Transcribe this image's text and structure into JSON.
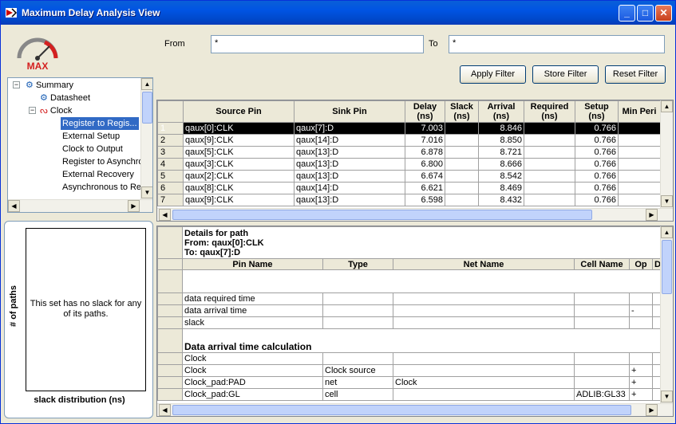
{
  "window": {
    "title": "Maximum Delay Analysis View",
    "min_icon": "minimize-icon",
    "max_icon": "maximize-icon",
    "close_icon": "close-icon"
  },
  "left": {
    "logo_text": "MAX",
    "tree": [
      {
        "label": "Summary",
        "icon": "summary-icon",
        "level": 0,
        "expander": "⊟"
      },
      {
        "label": "Datasheet",
        "icon": "datasheet-icon",
        "level": 1
      },
      {
        "label": "Clock",
        "icon": "clock-icon",
        "level": 1,
        "expander": "⊟"
      },
      {
        "label": "Register to Regis...",
        "level": 2,
        "selected": true
      },
      {
        "label": "External Setup",
        "level": 2
      },
      {
        "label": "Clock to Output",
        "level": 2
      },
      {
        "label": "Register to Asynchro",
        "level": 2
      },
      {
        "label": "External Recovery",
        "level": 2
      },
      {
        "label": "Asynchronous to Re",
        "level": 2
      }
    ],
    "histogram": {
      "ylabel": "# of paths",
      "xlabel": "slack distribution (ns)",
      "message": "This set has no slack for any of its paths."
    }
  },
  "filter": {
    "from_label": "From",
    "from_value": "*",
    "to_label": "To",
    "to_value": "*",
    "apply": "Apply Filter",
    "store": "Store Filter",
    "reset": "Reset Filter"
  },
  "paths_table": {
    "columns": [
      "Source Pin",
      "Sink Pin",
      "Delay (ns)",
      "Slack (ns)",
      "Arrival (ns)",
      "Required (ns)",
      "Setup (ns)",
      "Min Peri"
    ],
    "rows": [
      {
        "n": "1",
        "src": "qaux[0]:CLK",
        "sink": "qaux[7]:D",
        "delay": "7.003",
        "slack": "",
        "arrival": "8.846",
        "required": "",
        "setup": "0.766"
      },
      {
        "n": "2",
        "src": "qaux[9]:CLK",
        "sink": "qaux[14]:D",
        "delay": "7.016",
        "slack": "",
        "arrival": "8.850",
        "required": "",
        "setup": "0.766"
      },
      {
        "n": "3",
        "src": "qaux[5]:CLK",
        "sink": "qaux[13]:D",
        "delay": "6.878",
        "slack": "",
        "arrival": "8.721",
        "required": "",
        "setup": "0.766"
      },
      {
        "n": "4",
        "src": "qaux[3]:CLK",
        "sink": "qaux[13]:D",
        "delay": "6.800",
        "slack": "",
        "arrival": "8.666",
        "required": "",
        "setup": "0.766"
      },
      {
        "n": "5",
        "src": "qaux[2]:CLK",
        "sink": "qaux[13]:D",
        "delay": "6.674",
        "slack": "",
        "arrival": "8.542",
        "required": "",
        "setup": "0.766"
      },
      {
        "n": "6",
        "src": "qaux[8]:CLK",
        "sink": "qaux[14]:D",
        "delay": "6.621",
        "slack": "",
        "arrival": "8.469",
        "required": "",
        "setup": "0.766"
      },
      {
        "n": "7",
        "src": "qaux[9]:CLK",
        "sink": "qaux[13]:D",
        "delay": "6.598",
        "slack": "",
        "arrival": "8.432",
        "required": "",
        "setup": "0.766"
      }
    ]
  },
  "details": {
    "title": "Details for path",
    "from": "From: qaux[0]:CLK",
    "to": "To: qaux[7]:D",
    "columns": [
      "Pin Name",
      "Type",
      "Net Name",
      "Cell Name",
      "Op",
      "D"
    ],
    "rows": [
      {
        "pin": "data required time",
        "type": "",
        "net": "",
        "cell": "",
        "op": ""
      },
      {
        "pin": "data arrival time",
        "type": "",
        "net": "",
        "cell": "",
        "op": "-"
      },
      {
        "pin": "slack",
        "type": "",
        "net": "",
        "cell": "",
        "op": ""
      }
    ],
    "section": "Data arrival time calculation",
    "rows2": [
      {
        "pin": "Clock",
        "type": "",
        "net": "",
        "cell": "",
        "op": ""
      },
      {
        "pin": "Clock",
        "type": "Clock source",
        "net": "",
        "cell": "",
        "op": "+"
      },
      {
        "pin": "Clock_pad:PAD",
        "type": "net",
        "net": "Clock",
        "cell": "",
        "op": "+"
      },
      {
        "pin": "Clock_pad:GL",
        "type": "cell",
        "net": "",
        "cell": "ADLIB:GL33",
        "op": "+"
      }
    ]
  }
}
